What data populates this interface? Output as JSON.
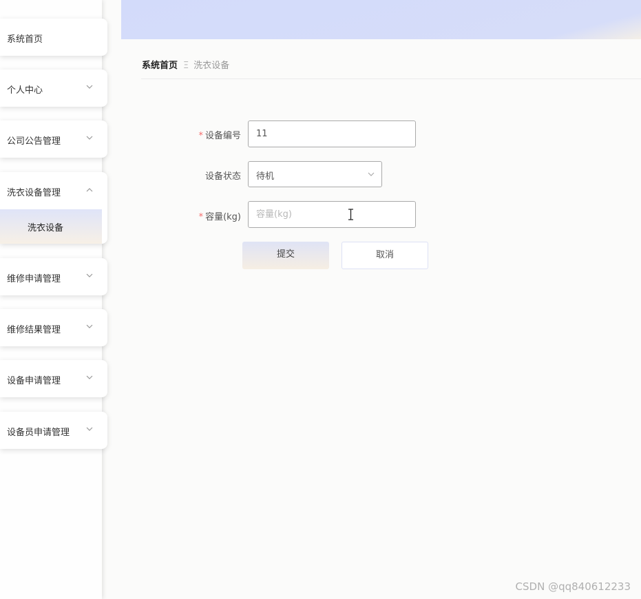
{
  "sidebar": {
    "items": [
      {
        "label": "系统首页"
      },
      {
        "label": "个人中心"
      },
      {
        "label": "公司公告管理"
      },
      {
        "label": "洗衣设备管理",
        "submenu": [
          "洗衣设备"
        ]
      },
      {
        "label": "维修申请管理"
      },
      {
        "label": "维修结果管理"
      },
      {
        "label": "设备申请管理"
      },
      {
        "label": "设备员申请管理"
      }
    ]
  },
  "breadcrumb": {
    "home": "系统首页",
    "separator": "Ξ",
    "current": "洗衣设备"
  },
  "form": {
    "device_number": {
      "required": "*",
      "label": "设备编号",
      "value": "11"
    },
    "device_status": {
      "label": "设备状态",
      "value": "待机"
    },
    "capacity": {
      "required": "*",
      "label": "容量(kg)",
      "value": "",
      "placeholder": "容量(kg)"
    },
    "submit_label": "提交",
    "cancel_label": "取消"
  },
  "watermark": "CSDN @qq840612233",
  "colors": {
    "accent": "#d3dbfa",
    "required": "#f56c6c",
    "gradient_warm": "#f6eee3"
  },
  "icons": {
    "chevron_down": "chevron-down-icon",
    "chevron_up": "chevron-up-icon",
    "text_cursor": "text-cursor-icon"
  }
}
